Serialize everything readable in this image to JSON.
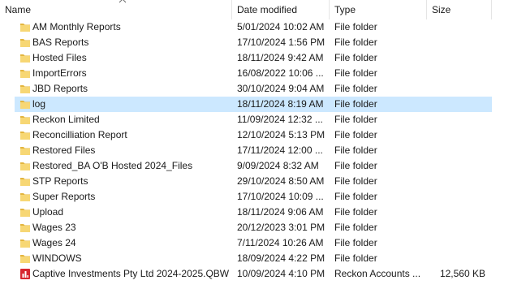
{
  "columns": {
    "name": "Name",
    "date_modified": "Date modified",
    "type": "Type",
    "size": "Size"
  },
  "sort": {
    "column": "name",
    "direction": "ascending",
    "icon": "sort-up-arrow-icon"
  },
  "colors": {
    "folder": "#f7d774",
    "folder_dark": "#e3b53e",
    "selected_row": "#cce8ff",
    "qbw_icon": "#d7262f"
  },
  "rows": [
    {
      "name": "AM Monthly Reports",
      "date": "5/01/2024 10:02 AM",
      "type": "File folder",
      "size": "",
      "icon": "folder-icon"
    },
    {
      "name": "BAS Reports",
      "date": "17/10/2024 1:56 PM",
      "type": "File folder",
      "size": "",
      "icon": "folder-icon"
    },
    {
      "name": "Hosted Files",
      "date": "18/11/2024 9:42 AM",
      "type": "File folder",
      "size": "",
      "icon": "folder-icon"
    },
    {
      "name": "ImportErrors",
      "date": "16/08/2022 10:06 ...",
      "type": "File folder",
      "size": "",
      "icon": "folder-icon"
    },
    {
      "name": "JBD Reports",
      "date": "30/10/2024 9:04 AM",
      "type": "File folder",
      "size": "",
      "icon": "folder-icon"
    },
    {
      "name": "log",
      "date": "18/11/2024 8:19 AM",
      "type": "File folder",
      "size": "",
      "icon": "folder-icon",
      "selected": true
    },
    {
      "name": "Reckon Limited",
      "date": "11/09/2024 12:32 ...",
      "type": "File folder",
      "size": "",
      "icon": "folder-icon"
    },
    {
      "name": "Reconcilliation Report",
      "date": "12/10/2024 5:13 PM",
      "type": "File folder",
      "size": "",
      "icon": "folder-icon"
    },
    {
      "name": "Restored Files",
      "date": "17/11/2024 12:00 ...",
      "type": "File folder",
      "size": "",
      "icon": "folder-icon"
    },
    {
      "name": "Restored_BA O'B Hosted 2024_Files",
      "date": "9/09/2024 8:32 AM",
      "type": "File folder",
      "size": "",
      "icon": "folder-icon"
    },
    {
      "name": "STP Reports",
      "date": "29/10/2024 8:50 AM",
      "type": "File folder",
      "size": "",
      "icon": "folder-icon"
    },
    {
      "name": "Super Reports",
      "date": "17/10/2024 10:09 ...",
      "type": "File folder",
      "size": "",
      "icon": "folder-icon"
    },
    {
      "name": "Upload",
      "date": "18/11/2024 9:06 AM",
      "type": "File folder",
      "size": "",
      "icon": "folder-icon"
    },
    {
      "name": "Wages 23",
      "date": "20/12/2023 3:01 PM",
      "type": "File folder",
      "size": "",
      "icon": "folder-icon"
    },
    {
      "name": "Wages 24",
      "date": "7/11/2024 10:26 AM",
      "type": "File folder",
      "size": "",
      "icon": "folder-icon"
    },
    {
      "name": "WINDOWS",
      "date": "18/09/2024 4:22 PM",
      "type": "File folder",
      "size": "",
      "icon": "folder-icon"
    },
    {
      "name": "Captive Investments Pty Ltd 2024-2025.QBW",
      "date": "10/09/2024 4:10 PM",
      "type": "Reckon Accounts ...",
      "size": "12,560 KB",
      "icon": "reckon-file-icon"
    }
  ]
}
